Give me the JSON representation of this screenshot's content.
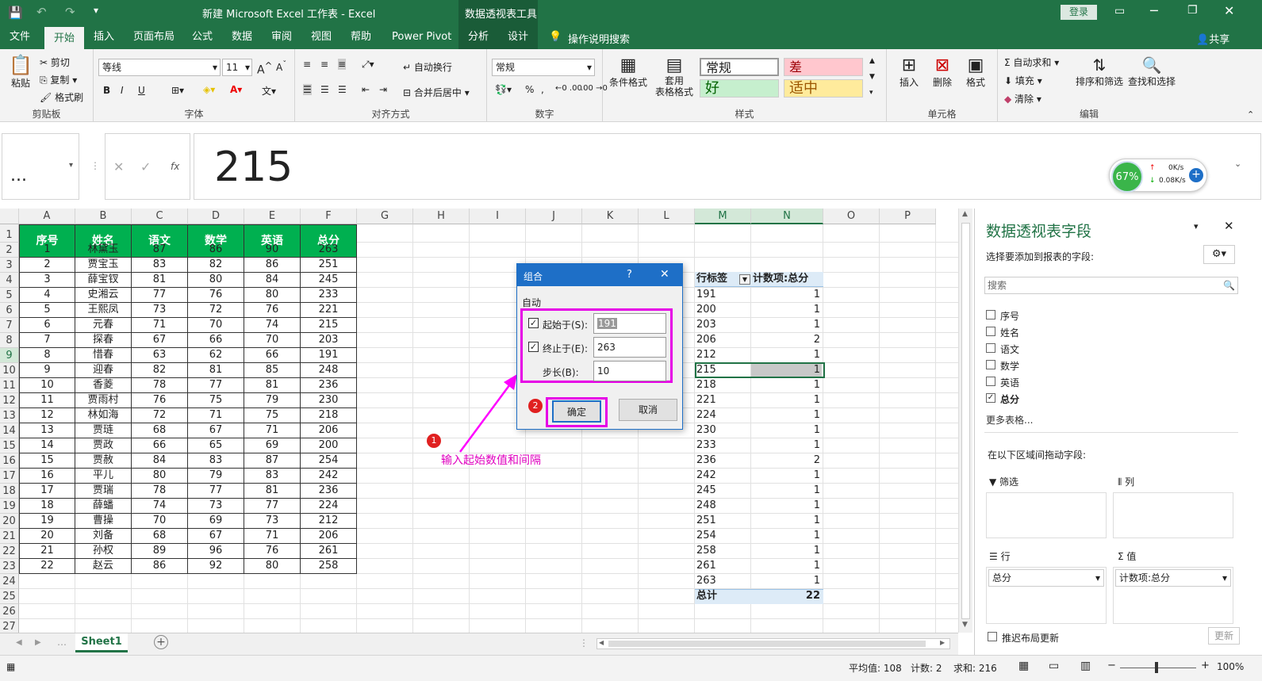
{
  "window": {
    "title": "新建 Microsoft Excel 工作表 - Excel",
    "context_tab": "数据透视表工具",
    "login": "登录"
  },
  "tabs": [
    "文件",
    "开始",
    "插入",
    "页面布局",
    "公式",
    "数据",
    "审阅",
    "视图",
    "帮助",
    "Power Pivot",
    "分析",
    "设计"
  ],
  "tell_me": "操作说明搜索",
  "share": "共享",
  "ribbon": {
    "clipboard": {
      "paste": "粘贴",
      "cut": "剪切",
      "copy": "复制",
      "format_painter": "格式刷",
      "label": "剪贴板"
    },
    "font": {
      "name": "等线",
      "size": "11",
      "label": "字体",
      "bold": "B",
      "italic": "I",
      "underline": "U"
    },
    "align": {
      "wrap": "自动换行",
      "merge": "合并后居中",
      "label": "对齐方式"
    },
    "number": {
      "format": "常规",
      "label": "数字"
    },
    "styles": {
      "cond": "条件格式",
      "table": "套用\n表格格式",
      "normal": "常规",
      "bad": "差",
      "good": "好",
      "neutral": "适中",
      "label": "样式"
    },
    "cells": {
      "insert": "插入",
      "delete": "删除",
      "format": "格式",
      "label": "单元格"
    },
    "edit": {
      "autosum": "自动求和",
      "fill": "填充",
      "clear": "清除",
      "sort": "排序和筛选",
      "find": "查找和选择",
      "label": "编辑"
    }
  },
  "formula": {
    "namebox": "...",
    "value": "215",
    "fx": "fx"
  },
  "net": {
    "pct": "67%",
    "up": "0K/s",
    "down": "0.08K/s"
  },
  "columns": [
    "A",
    "B",
    "C",
    "D",
    "E",
    "F",
    "G",
    "H",
    "I",
    "J",
    "K",
    "L",
    "M",
    "N",
    "O",
    "P"
  ],
  "rows": [
    "1",
    "2",
    "3",
    "4",
    "5",
    "6",
    "7",
    "8",
    "9",
    "10",
    "11",
    "12",
    "13",
    "14",
    "15",
    "16",
    "17",
    "18",
    "19",
    "20",
    "21",
    "22",
    "23",
    "24",
    "25",
    "26",
    "27"
  ],
  "table": {
    "headers": [
      "序号",
      "姓名",
      "语文",
      "数学",
      "英语",
      "总分"
    ],
    "rows": [
      [
        "1",
        "林黛玉",
        "87",
        "86",
        "90",
        "263"
      ],
      [
        "2",
        "贾宝玉",
        "83",
        "82",
        "86",
        "251"
      ],
      [
        "3",
        "薛宝钗",
        "81",
        "80",
        "84",
        "245"
      ],
      [
        "4",
        "史湘云",
        "77",
        "76",
        "80",
        "233"
      ],
      [
        "5",
        "王熙凤",
        "73",
        "72",
        "76",
        "221"
      ],
      [
        "6",
        "元春",
        "71",
        "70",
        "74",
        "215"
      ],
      [
        "7",
        "探春",
        "67",
        "66",
        "70",
        "203"
      ],
      [
        "8",
        "惜春",
        "63",
        "62",
        "66",
        "191"
      ],
      [
        "9",
        "迎春",
        "82",
        "81",
        "85",
        "248"
      ],
      [
        "10",
        "香菱",
        "78",
        "77",
        "81",
        "236"
      ],
      [
        "11",
        "贾雨村",
        "76",
        "75",
        "79",
        "230"
      ],
      [
        "12",
        "林如海",
        "72",
        "71",
        "75",
        "218"
      ],
      [
        "13",
        "贾琏",
        "68",
        "67",
        "71",
        "206"
      ],
      [
        "14",
        "贾政",
        "66",
        "65",
        "69",
        "200"
      ],
      [
        "15",
        "贾赦",
        "84",
        "83",
        "87",
        "254"
      ],
      [
        "16",
        "平儿",
        "80",
        "79",
        "83",
        "242"
      ],
      [
        "17",
        "贾瑞",
        "78",
        "77",
        "81",
        "236"
      ],
      [
        "18",
        "薛蟠",
        "74",
        "73",
        "77",
        "224"
      ],
      [
        "19",
        "曹操",
        "70",
        "69",
        "73",
        "212"
      ],
      [
        "20",
        "刘备",
        "68",
        "67",
        "71",
        "206"
      ],
      [
        "21",
        "孙权",
        "89",
        "96",
        "76",
        "261"
      ],
      [
        "22",
        "赵云",
        "86",
        "92",
        "80",
        "258"
      ]
    ]
  },
  "pivot": {
    "header_label": "行标签",
    "header_value": "计数项:总分",
    "rows": [
      [
        "191",
        "1"
      ],
      [
        "200",
        "1"
      ],
      [
        "203",
        "1"
      ],
      [
        "206",
        "2"
      ],
      [
        "212",
        "1"
      ],
      [
        "215",
        "1"
      ],
      [
        "218",
        "1"
      ],
      [
        "221",
        "1"
      ],
      [
        "224",
        "1"
      ],
      [
        "230",
        "1"
      ],
      [
        "233",
        "1"
      ],
      [
        "236",
        "2"
      ],
      [
        "242",
        "1"
      ],
      [
        "245",
        "1"
      ],
      [
        "248",
        "1"
      ],
      [
        "251",
        "1"
      ],
      [
        "254",
        "1"
      ],
      [
        "258",
        "1"
      ],
      [
        "261",
        "1"
      ],
      [
        "263",
        "1"
      ]
    ],
    "total_label": "总计",
    "total_value": "22"
  },
  "dialog": {
    "title": "组合",
    "help": "?",
    "section": "自动",
    "start_label": "起始于(S):",
    "start_value": "191",
    "end_label": "终止于(E):",
    "end_value": "263",
    "step_label": "步长(B):",
    "step_value": "10",
    "ok": "确定",
    "cancel": "取消"
  },
  "annotation": {
    "badge1": "1",
    "badge2": "2",
    "text": "输入起始数值和间隔",
    "color": "#ff00ff"
  },
  "sheet": {
    "tab": "Sheet1"
  },
  "panel": {
    "title": "数据透视表字段",
    "subtitle": "选择要添加到报表的字段:",
    "search_placeholder": "搜索",
    "fields": [
      "序号",
      "姓名",
      "语文",
      "数学",
      "英语",
      "总分"
    ],
    "more": "更多表格...",
    "drag_label": "在以下区域间拖动字段:",
    "filter": "筛选",
    "columns": "列",
    "rows": "行",
    "values": "值",
    "row_item": "总分",
    "value_item": "计数项:总分",
    "defer": "推迟布局更新",
    "update": "更新"
  },
  "status": {
    "avg": "平均值: 108",
    "count": "计数: 2",
    "sum": "求和: 216",
    "zoom": "100%"
  }
}
